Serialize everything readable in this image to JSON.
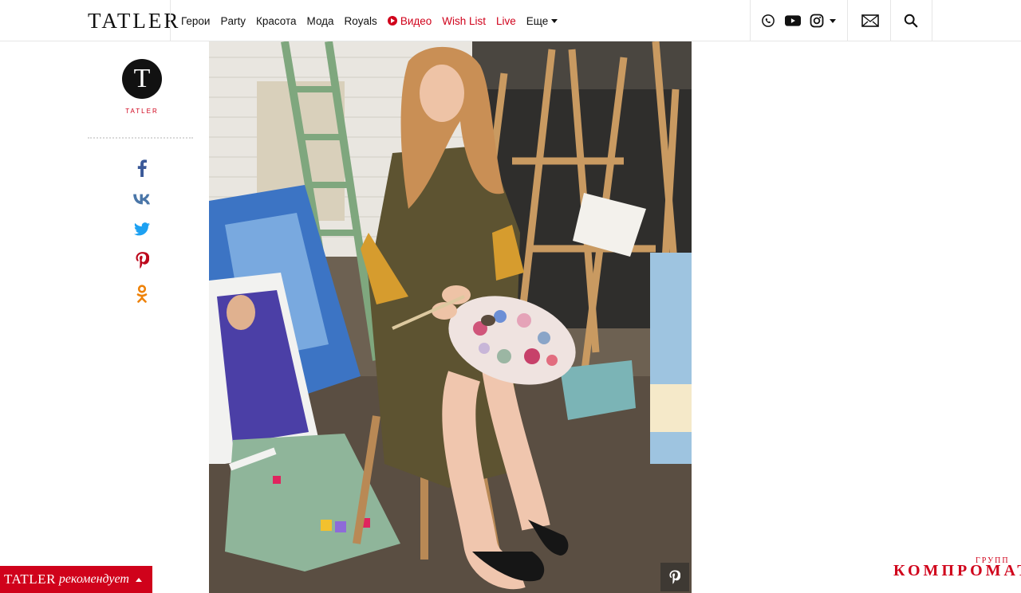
{
  "header": {
    "logo": "TATLER",
    "nav": [
      {
        "label": "Герои"
      },
      {
        "label": "Party"
      },
      {
        "label": "Красота"
      },
      {
        "label": "Мода"
      },
      {
        "label": "Royals"
      },
      {
        "label": "Видео"
      },
      {
        "label": "Wish List"
      },
      {
        "label": "Live"
      },
      {
        "label": "Еще"
      }
    ],
    "social_icons": [
      "viber-icon",
      "youtube-icon",
      "instagram-icon"
    ],
    "actions": [
      "mail-icon",
      "search-icon"
    ]
  },
  "sidebar": {
    "badge_letter": "T",
    "badge_caption": "TATLER",
    "share": [
      "facebook-icon",
      "vk-icon",
      "twitter-icon",
      "pinterest-icon",
      "odnoklassniki-icon"
    ]
  },
  "photo": {
    "pin_icon": "pinterest-icon"
  },
  "recommend": {
    "brand": "TATLER",
    "text": "рекомендует"
  },
  "watermark": {
    "small": "ГРУПП",
    "main": "КОМПРОМАТ"
  },
  "colors": {
    "accent_red": "#d0021b",
    "facebook": "#3b5998",
    "vk": "#4a76a8",
    "twitter": "#1da1f2",
    "pinterest": "#bd081c",
    "odnoklassniki": "#ee8208"
  }
}
